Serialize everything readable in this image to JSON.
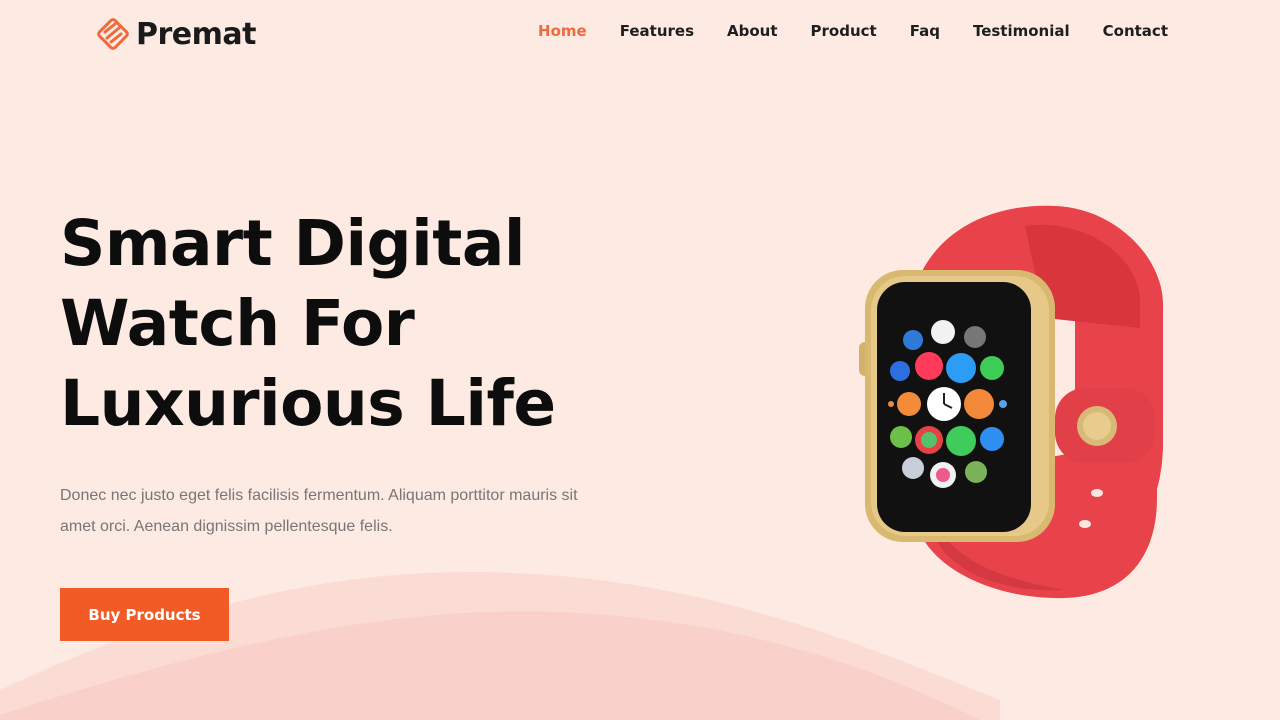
{
  "brand": {
    "name": "Premat",
    "logo_icon": "layered-diamond-logo-icon",
    "accent_color": "#ef6a3c"
  },
  "nav": {
    "items": [
      {
        "label": "Home",
        "active": true
      },
      {
        "label": "Features",
        "active": false
      },
      {
        "label": "About",
        "active": false
      },
      {
        "label": "Product",
        "active": false
      },
      {
        "label": "Faq",
        "active": false
      },
      {
        "label": "Testimonial",
        "active": false
      },
      {
        "label": "Contact",
        "active": false
      }
    ]
  },
  "hero": {
    "title_lines": [
      "Smart Digital",
      "Watch For",
      "Luxurious Life"
    ],
    "description": "Donec nec justo eget felis facilisis fermentum. Aliquam porttitor mauris sit amet orci. Aenean dignissim pellentesque felis.",
    "cta_label": "Buy Products",
    "cta_color": "#f25a26",
    "background_color": "#fdebe3"
  },
  "product_image": {
    "icon": "smartwatch-image",
    "band_color": "#e8434a",
    "case_color": "#d9b870"
  }
}
